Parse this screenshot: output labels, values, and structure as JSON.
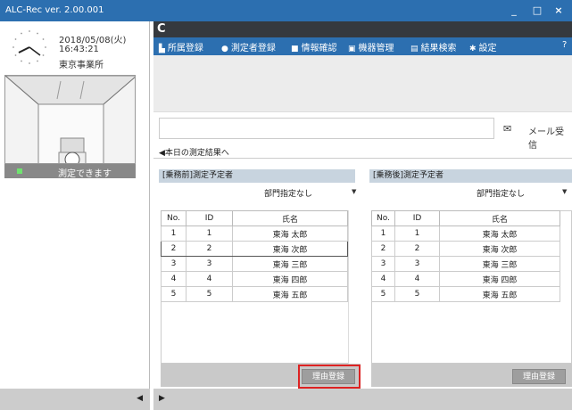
{
  "window": {
    "title": "ALC-Rec  ver. 2.00.001",
    "minimize": "_",
    "maximize": "□",
    "close": "×"
  },
  "left": {
    "date": "2018/05/08(火)",
    "time": "16:43:21",
    "office": "東京事業所",
    "status": "測定できます",
    "status_color": "#6fe26f"
  },
  "toolbar": {
    "items": [
      {
        "icon": "building-icon",
        "label": "所属登録"
      },
      {
        "icon": "person-icon",
        "label": "測定者登録"
      },
      {
        "icon": "book-icon",
        "label": "情報確認"
      },
      {
        "icon": "device-icon",
        "label": "機器管理"
      },
      {
        "icon": "calendar-icon",
        "label": "結果検索"
      },
      {
        "icon": "gear-icon",
        "label": "設定"
      }
    ],
    "help": "?"
  },
  "mail": {
    "input_value": "",
    "recv_label": "メール受信"
  },
  "today_link": "◀本日の測定結果へ",
  "panels": {
    "before": {
      "title": "[乗務前]測定予定者",
      "dept": "部門指定なし",
      "button": "理由登録"
    },
    "after": {
      "title": "[乗務後]測定予定者",
      "dept": "部門指定なし",
      "button": "理由登録"
    }
  },
  "table": {
    "headers": [
      "No.",
      "ID",
      "氏名"
    ],
    "rows": [
      [
        "1",
        "1",
        "東海  太郎"
      ],
      [
        "2",
        "2",
        "東海  次郎"
      ],
      [
        "3",
        "3",
        "東海  三郎"
      ],
      [
        "4",
        "4",
        "東海  四郎"
      ],
      [
        "5",
        "5",
        "東海  五郎"
      ]
    ]
  },
  "colors": {
    "brand": "#2c6fb0",
    "highlight": "#d22222"
  }
}
